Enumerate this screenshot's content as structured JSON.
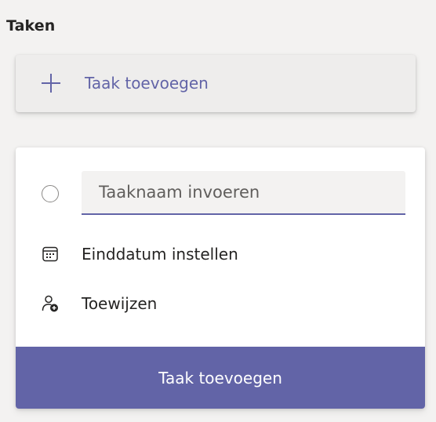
{
  "section": {
    "title": "Taken"
  },
  "add_task_card": {
    "label": "Taak toevoegen",
    "icon": "plus-icon"
  },
  "new_task_form": {
    "completion_icon": "circle-radio-icon",
    "name_input": {
      "value": "",
      "placeholder": "Taaknaam invoeren"
    },
    "due_date": {
      "icon": "calendar-icon",
      "label": "Einddatum instellen"
    },
    "assign": {
      "icon": "person-add-icon",
      "label": "Toewijzen"
    },
    "submit_label": "Taak toevoegen"
  },
  "colors": {
    "accent": "#6264a7",
    "background": "#f3f2f1",
    "panel": "#ffffff",
    "text": "#252423"
  }
}
